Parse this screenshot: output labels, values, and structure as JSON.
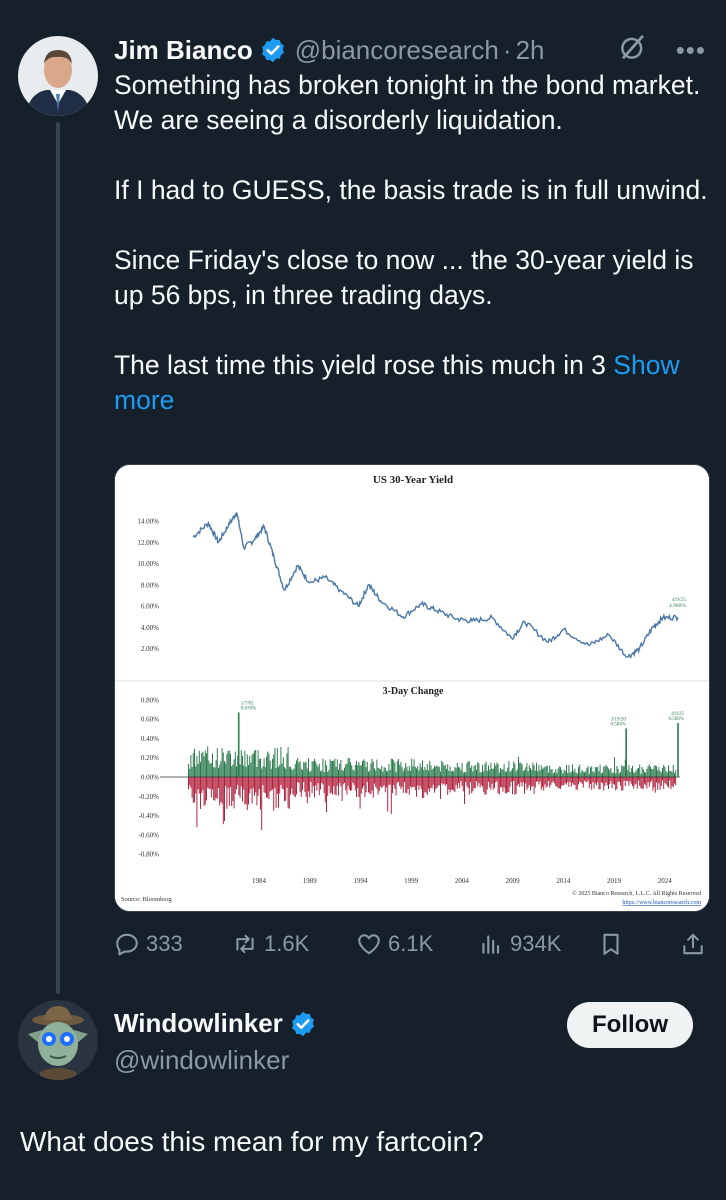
{
  "tweet": {
    "author_name": "Jim Bianco",
    "handle": "@biancoresearch",
    "separator": "·",
    "time": "2h",
    "paragraphs": [
      "Something has broken tonight in the bond market. We are seeing a disorderly liquidation.",
      "If I had to GUESS, the basis trade is in full unwind.",
      "Since Friday's close to now ... the 30-year yield is up 56 bps, in three trading days."
    ],
    "truncated_text": "The last time this yield rose this much in 3",
    "show_more": "Show more",
    "stats": {
      "replies": "333",
      "reposts": "1.6K",
      "likes": "6.1K",
      "views": "934K"
    }
  },
  "reply": {
    "author_name": "Windowlinker",
    "handle": "@windowlinker",
    "follow_label": "Follow",
    "text": "What does this mean for my fartcoin?"
  },
  "icons": [
    "verified-badge-icon",
    "grok-icon",
    "more-icon",
    "reply-icon",
    "retweet-icon",
    "heart-icon",
    "views-icon",
    "bookmark-icon",
    "share-icon"
  ],
  "colors": {
    "background": "#15202b",
    "accent": "#1d9bf0",
    "muted": "#8b98a5",
    "series_line": "#4a77a8",
    "positive_bar": "#2e7d4f",
    "negative_bar": "#b3243f"
  },
  "chart_data": [
    {
      "type": "line",
      "title": "US 30-Year Yield",
      "y_ticks": [
        "14.00%",
        "12.00%",
        "10.00%",
        "8.00%",
        "6.00%",
        "4.00%",
        "2.00%"
      ],
      "ylim": [
        0,
        15.5
      ],
      "x": [
        1977.5,
        1979,
        1980,
        1981,
        1981.8,
        1982.5,
        1983.5,
        1984.5,
        1985.5,
        1986.5,
        1987.8,
        1989,
        1990.5,
        1992,
        1993.8,
        1994.8,
        1996,
        1998.2,
        2000,
        2001.5,
        2003.5,
        2005,
        2007,
        2008.9,
        2010.2,
        2012.5,
        2014,
        2016.5,
        2018.5,
        2020.3,
        2021.5,
        2022.8,
        2023.8,
        2025.3
      ],
      "values": [
        12.5,
        13.8,
        12.0,
        13.6,
        14.8,
        11.5,
        12.2,
        13.5,
        10.5,
        7.5,
        9.8,
        8.2,
        8.7,
        7.5,
        6.0,
        8.0,
        6.5,
        5.0,
        6.2,
        5.6,
        4.8,
        4.6,
        4.9,
        3.0,
        4.5,
        2.6,
        3.8,
        2.3,
        3.3,
        1.2,
        2.0,
        4.0,
        4.9,
        4.96
      ],
      "annotations": [
        {
          "label": "4/9/25",
          "value_label": "4.960%"
        }
      ]
    },
    {
      "type": "bar",
      "title": "3-Day Change",
      "y_ticks": [
        "0.80%",
        "0.60%",
        "0.40%",
        "0.20%",
        "0.00%",
        "-0.20%",
        "-0.40%",
        "-0.60%",
        "-0.80%"
      ],
      "ylim": [
        -0.85,
        0.85
      ],
      "x_ticks": [
        "1984",
        "1989",
        "1994",
        "1999",
        "2004",
        "2009",
        "2014",
        "2019",
        "2024"
      ],
      "xlim": [
        1977,
        2025.5
      ],
      "annotations": [
        {
          "label": "1/7/82",
          "value_label": "0.670%",
          "x": 1982.0,
          "y": 0.67
        },
        {
          "label": "3/19/20",
          "value_label": "0.504%",
          "x": 2020.2,
          "y": 0.504
        },
        {
          "label": "4/9/25",
          "value_label": "0.560%",
          "x": 2025.3,
          "y": 0.56
        }
      ],
      "source": "Source: Bloomberg",
      "copyright": "© 2025 Bianco Research, L.L.C. All Rights Reserved",
      "url": "https://www.biancoresearch.com"
    }
  ]
}
